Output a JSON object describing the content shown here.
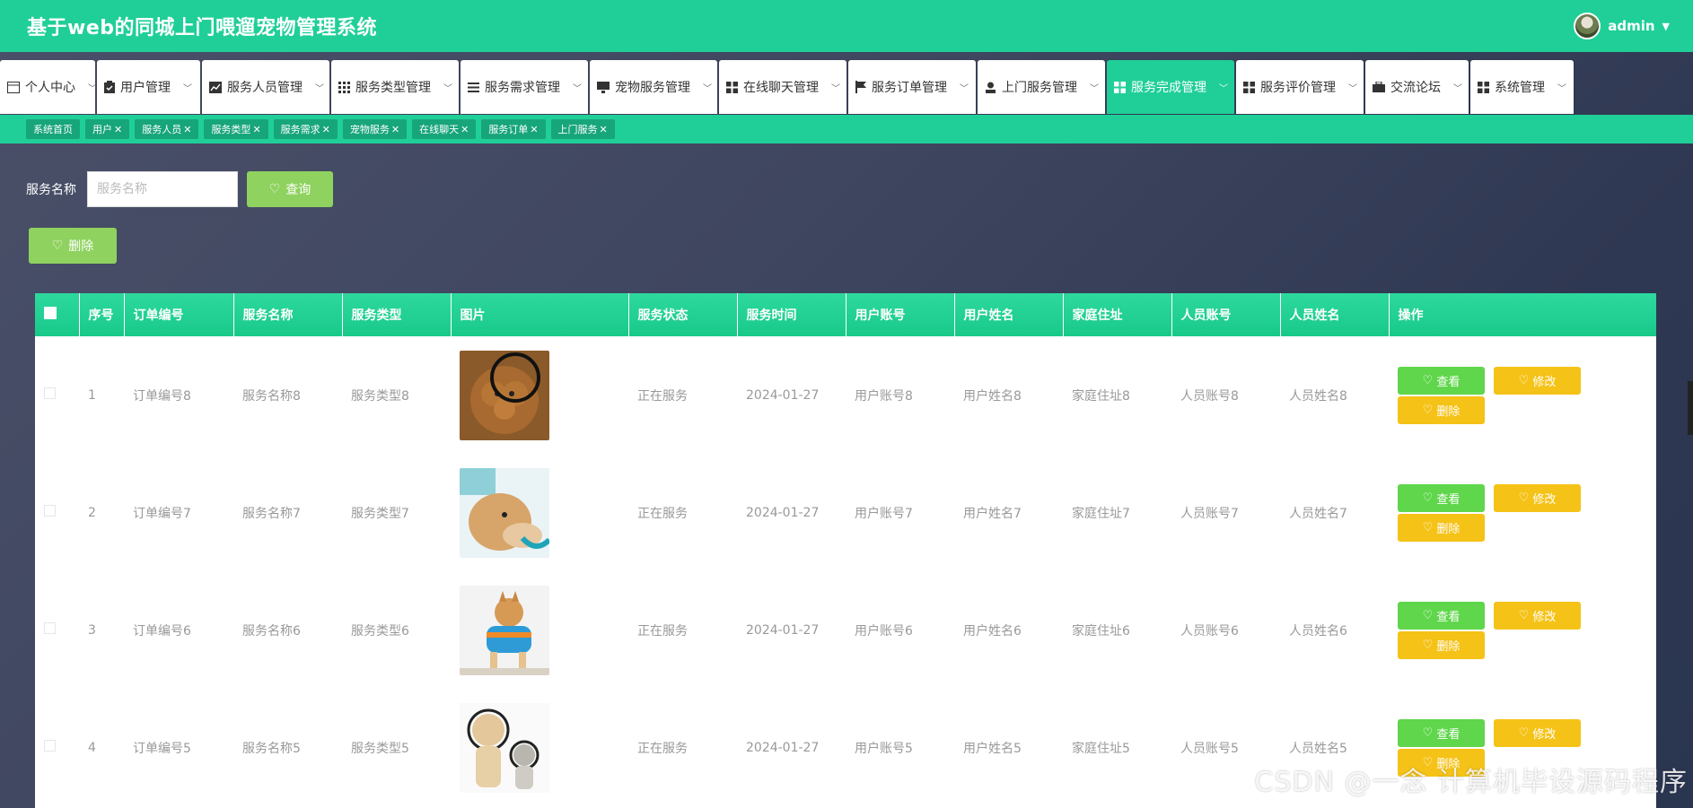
{
  "header": {
    "title": "基于web的同城上门喂遛宠物管理系统",
    "username": "admin"
  },
  "nav": [
    {
      "label": "个人中心",
      "icon": "card-icon",
      "active": false
    },
    {
      "label": "用户管理",
      "icon": "clipboard-icon",
      "active": false
    },
    {
      "label": "服务人员管理",
      "icon": "chart-icon",
      "active": false
    },
    {
      "label": "服务类型管理",
      "icon": "grid-icon",
      "active": false
    },
    {
      "label": "服务需求管理",
      "icon": "list-icon",
      "active": false
    },
    {
      "label": "宠物服务管理",
      "icon": "monitor-icon",
      "active": false
    },
    {
      "label": "在线聊天管理",
      "icon": "apps-icon",
      "active": false
    },
    {
      "label": "服务订单管理",
      "icon": "flag-icon",
      "active": false
    },
    {
      "label": "上门服务管理",
      "icon": "user-icon",
      "active": false
    },
    {
      "label": "服务完成管理",
      "icon": "apps-icon",
      "active": true
    },
    {
      "label": "服务评价管理",
      "icon": "apps-icon",
      "active": false
    },
    {
      "label": "交流论坛",
      "icon": "briefcase-icon",
      "active": false
    },
    {
      "label": "系统管理",
      "icon": "apps-icon",
      "active": false
    }
  ],
  "tags": [
    "系统首页",
    "用户",
    "服务人员",
    "服务类型",
    "服务需求",
    "宠物服务",
    "在线聊天",
    "服务订单",
    "上门服务"
  ],
  "search": {
    "label": "服务名称",
    "placeholder": "服务名称",
    "query_label": "查询"
  },
  "toolbar": {
    "delete_label": "删除"
  },
  "table": {
    "columns": [
      "序号",
      "订单编号",
      "服务名称",
      "服务类型",
      "图片",
      "服务状态",
      "服务时间",
      "用户账号",
      "用户姓名",
      "家庭住址",
      "人员账号",
      "人员姓名",
      "操作"
    ],
    "rows": [
      {
        "index": "1",
        "order_no": "订单编号8",
        "service_name": "服务名称8",
        "service_type": "服务类型8",
        "status": "正在服务",
        "time": "2024-01-27",
        "user_account": "用户账号8",
        "user_name": "用户姓名8",
        "address": "家庭住址8",
        "staff_account": "人员账号8",
        "staff_name": "人员姓名8",
        "image": "poodle-photo"
      },
      {
        "index": "2",
        "order_no": "订单编号7",
        "service_name": "服务名称7",
        "service_type": "服务类型7",
        "status": "正在服务",
        "time": "2024-01-27",
        "user_account": "用户账号7",
        "user_name": "用户姓名7",
        "address": "家庭住址7",
        "staff_account": "人员账号7",
        "staff_name": "人员姓名7",
        "image": "chihuahua-photo"
      },
      {
        "index": "3",
        "order_no": "订单编号6",
        "service_name": "服务名称6",
        "service_type": "服务类型6",
        "status": "正在服务",
        "time": "2024-01-27",
        "user_account": "用户账号6",
        "user_name": "用户姓名6",
        "address": "家庭住址6",
        "staff_account": "人员账号6",
        "staff_name": "人员姓名6",
        "image": "shiba-photo"
      },
      {
        "index": "4",
        "order_no": "订单编号5",
        "service_name": "服务名称5",
        "service_type": "服务类型5",
        "status": "正在服务",
        "time": "2024-01-27",
        "user_account": "用户账号5",
        "user_name": "用户姓名5",
        "address": "家庭住址5",
        "staff_account": "人员账号5",
        "staff_name": "人员姓名5",
        "image": "dog-cat-photo"
      }
    ],
    "actions": {
      "view": "查看",
      "edit": "修改",
      "delete": "删除"
    }
  },
  "watermark": "CSDN @一念 计算机毕设源码程序",
  "colors": {
    "primary": "#20cf98",
    "tag": "#17a57a",
    "green_btn": "#8fd25f",
    "view": "#5fd64b",
    "edit": "#f5c217"
  }
}
